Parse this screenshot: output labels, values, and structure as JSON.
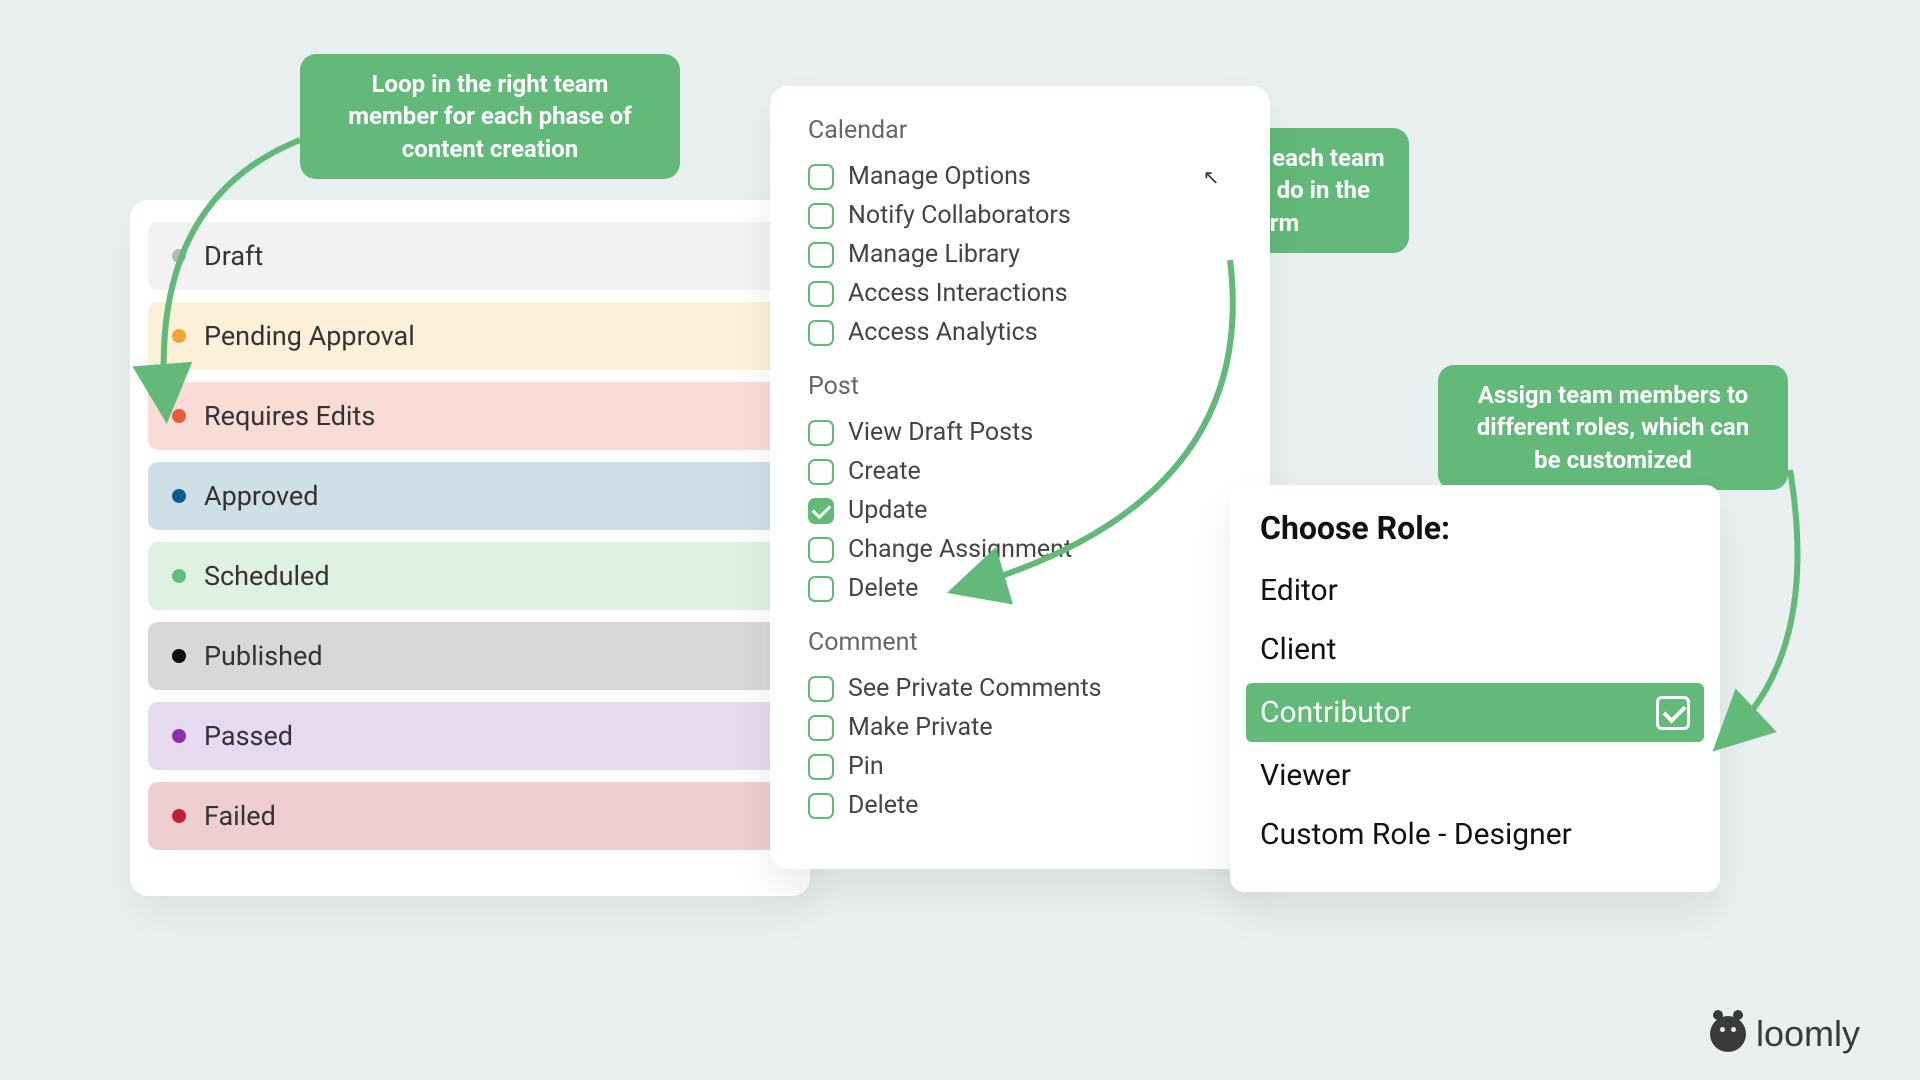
{
  "callouts": {
    "left": "Loop in the right team member for each phase of content creation",
    "middle": "Manage what each team member can do in the platform",
    "right": "Assign team members to different roles, which can be customized"
  },
  "statuses": [
    {
      "label": "Draft",
      "bg": "#f2f2f2",
      "dot": "#b8b8b8"
    },
    {
      "label": "Pending Approval",
      "bg": "#fdf0d8",
      "dot": "#f1a63c"
    },
    {
      "label": "Requires Edits",
      "bg": "#f9dcd6",
      "dot": "#e75b3e"
    },
    {
      "label": "Approved",
      "bg": "#cfdfe8",
      "dot": "#0f5a8f"
    },
    {
      "label": "Scheduled",
      "bg": "#dff1e1",
      "dot": "#61c078"
    },
    {
      "label": "Published",
      "bg": "#d8d8d8",
      "dot": "#0d0d0d"
    },
    {
      "label": "Passed",
      "bg": "#e7d9ef",
      "dot": "#8b2fb1"
    },
    {
      "label": "Failed",
      "bg": "#efced1",
      "dot": "#c0202f"
    }
  ],
  "permissions": {
    "sections": [
      {
        "title": "Calendar",
        "items": [
          {
            "label": "Manage Options",
            "checked": false,
            "cursor": true
          },
          {
            "label": "Notify Collaborators",
            "checked": false
          },
          {
            "label": "Manage Library",
            "checked": false
          },
          {
            "label": "Access Interactions",
            "checked": false
          },
          {
            "label": "Access Analytics",
            "checked": false
          }
        ]
      },
      {
        "title": "Post",
        "items": [
          {
            "label": "View Draft Posts",
            "checked": false
          },
          {
            "label": "Create",
            "checked": false
          },
          {
            "label": "Update",
            "checked": true
          },
          {
            "label": "Change Assignment",
            "checked": false
          },
          {
            "label": "Delete",
            "checked": false
          }
        ]
      },
      {
        "title": "Comment",
        "items": [
          {
            "label": "See Private Comments",
            "checked": false
          },
          {
            "label": "Make Private",
            "checked": false
          },
          {
            "label": "Pin",
            "checked": false
          },
          {
            "label": "Delete",
            "checked": false
          }
        ]
      }
    ]
  },
  "roles": {
    "title": "Choose Role:",
    "items": [
      {
        "label": "Editor",
        "selected": false
      },
      {
        "label": "Client",
        "selected": false
      },
      {
        "label": "Contributor",
        "selected": true
      },
      {
        "label": "Viewer",
        "selected": false
      },
      {
        "label": "Custom Role - Designer",
        "selected": false
      }
    ]
  },
  "brand": "loomly",
  "accent": "#62b979"
}
